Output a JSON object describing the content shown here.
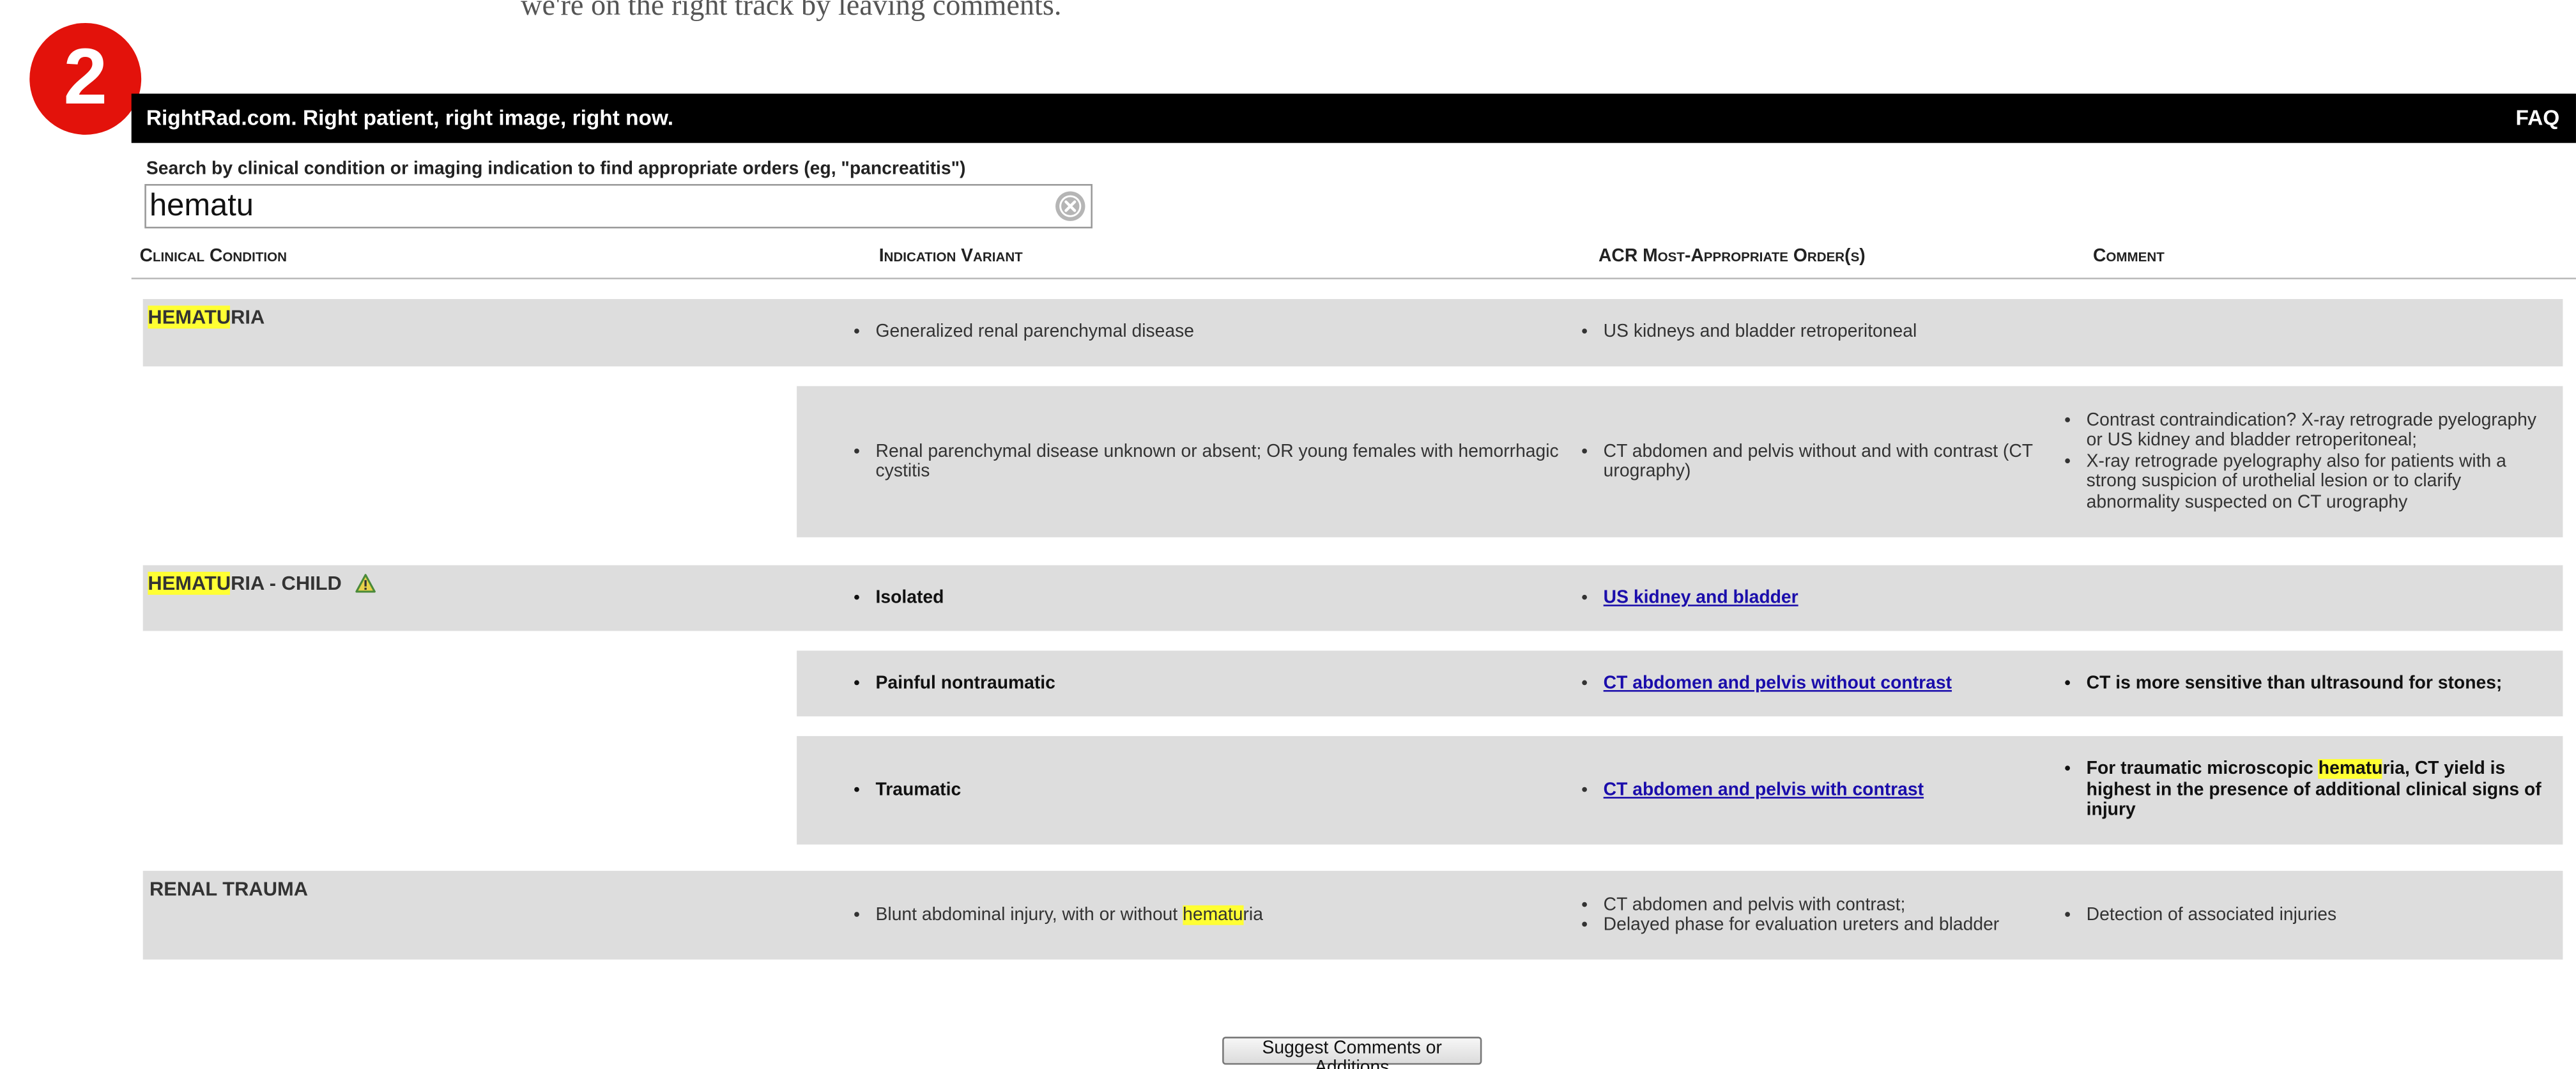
{
  "intro_text": "we're on the right track by leaving comments.",
  "step_badge": "2",
  "header": {
    "brand": "RightRad.com. Right patient, right image, right now.",
    "faq": "FAQ"
  },
  "search": {
    "label": "Search by clinical condition or imaging indication to find appropriate orders (eg, \"pancreatitis\")",
    "value": "hematu",
    "clear_icon": "clear-circle-x-icon"
  },
  "columns": {
    "clinical_condition": "Clinical Condition",
    "indication_variant": "Indication Variant",
    "acr_order": "ACR Most-Appropriate Order(s)",
    "comment": "Comment"
  },
  "highlight_color": "#ffff33",
  "conditions": [
    {
      "name_highlight": "HEMATU",
      "name_rest": "RIA",
      "rows": [
        {
          "variant": "Generalized renal parenchymal disease",
          "orders": [
            "US kidneys and bladder retroperitoneal"
          ],
          "comments": []
        },
        {
          "variant": "Renal parenchymal disease unknown or absent; OR young females with hemorrhagic cystitis",
          "orders": [
            "CT abdomen and pelvis without and with contrast (CT urography)"
          ],
          "comments": [
            "Contrast contraindication? X-ray retrograde pyelography or US kidney and bladder retroperitoneal;",
            "X-ray retrograde pyelography also for patients with a strong suspicion of urothelial lesion or to clarify abnormality suspected on CT urography"
          ]
        }
      ]
    },
    {
      "name_highlight": "HEMATU",
      "name_rest": "RIA - CHILD",
      "icon": "warning-triangle-icon",
      "rows": [
        {
          "variant": "Isolated",
          "orders": [
            "US kidney and bladder"
          ],
          "comments": []
        },
        {
          "variant": "Painful nontraumatic",
          "orders": [
            "CT abdomen and pelvis without contrast"
          ],
          "comments": [
            "CT is more sensitive than ultrasound for stones;"
          ]
        },
        {
          "variant": "Traumatic",
          "orders": [
            "CT abdomen and pelvis with contrast"
          ],
          "comments": [
            {
              "before": "For traumatic microscopic ",
              "highlight": "hematu",
              "after": "ria, CT yield is highest in the presence of additional clinical signs of injury"
            }
          ]
        }
      ]
    },
    {
      "name": "RENAL TRAUMA",
      "rows": [
        {
          "variant": {
            "before": "Blunt abdominal injury, with or without ",
            "highlight": "hematu",
            "after": "ria"
          },
          "orders": [
            "CT abdomen and pelvis with contrast;",
            "Delayed phase for evaluation ureters and bladder"
          ],
          "comments": [
            "Detection of associated injuries"
          ]
        }
      ]
    }
  ],
  "suggest_button": "Suggest Comments or Additions"
}
